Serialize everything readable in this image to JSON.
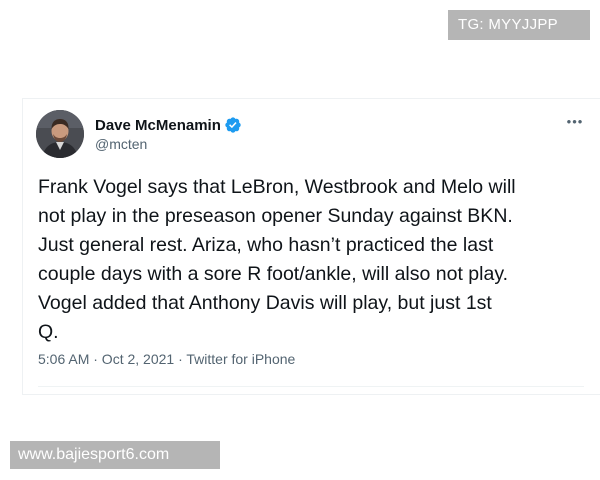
{
  "watermarks": {
    "top_right": "TG: MYYJJPP",
    "bottom_left": "www.bajiesport6.com"
  },
  "tweet": {
    "author": {
      "name": "Dave McMenamin",
      "handle": "@mcten",
      "verified": true,
      "avatar_icon": "profile-photo"
    },
    "more_label": "•••",
    "body_lines": [
      "Frank Vogel says that LeBron, Westbrook and Melo will",
      "not play in the preseason opener Sunday against BKN.",
      "Just general rest. Ariza, who hasn’t practiced the last",
      "couple days with a sore R foot/ankle, will also not play.",
      "Vogel added that Anthony Davis will play, but just 1st",
      "Q."
    ],
    "meta": {
      "time": "5:06 AM",
      "date": "Oct 2, 2021",
      "source": "Twitter for iPhone",
      "full": "5:06 AM · Oct 2, 2021 · Twitter for iPhone"
    }
  },
  "colors": {
    "verified_blue": "#1d9bf0",
    "text_primary": "#0f1419",
    "text_secondary": "#536471",
    "watermark_bg": "#b5b5b5"
  }
}
